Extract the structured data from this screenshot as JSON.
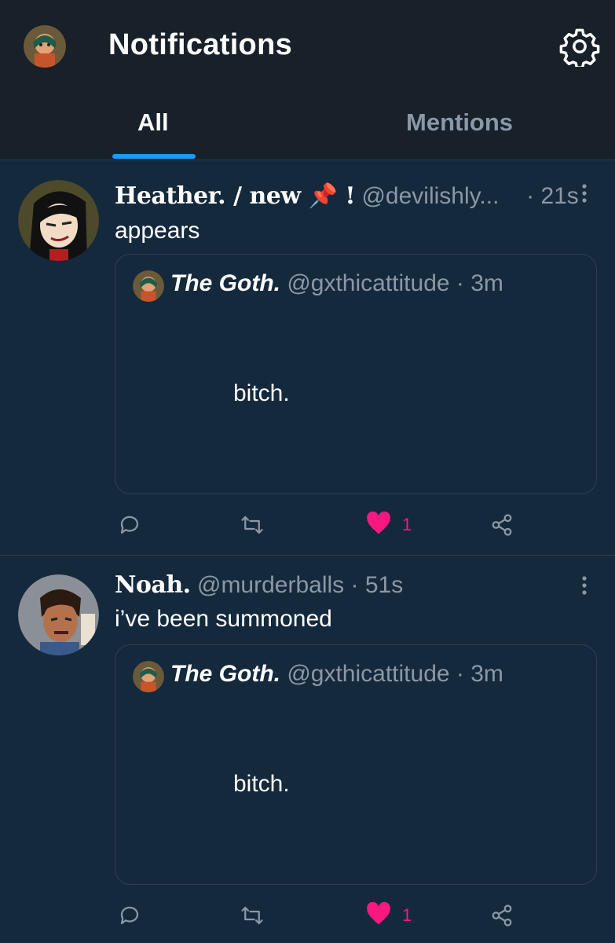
{
  "header": {
    "title": "Notifications",
    "tabs": [
      {
        "label": "All",
        "active": true
      },
      {
        "label": "Mentions",
        "active": false
      }
    ]
  },
  "notifications": [
    {
      "display_name": "Heather. / new 📌 !",
      "handle": "@devilishly...",
      "dot": "·",
      "time": "21s",
      "text": "appears",
      "quote": {
        "display_name": "The Goth.",
        "handle": "@gxthicattitude",
        "dot": "·",
        "time": "3m",
        "text": "bitch."
      },
      "actions": {
        "likes": "1"
      }
    },
    {
      "display_name": "Noah.",
      "handle": "@murderballs",
      "dot": "·",
      "time": "51s",
      "text": "i’ve been summoned",
      "quote": {
        "display_name": "The Goth.",
        "handle": "@gxthicattitude",
        "dot": "·",
        "time": "3m",
        "text": "bitch."
      },
      "actions": {
        "likes": "1"
      }
    }
  ],
  "colors": {
    "background": "#15293d",
    "header": "#18202a",
    "accent": "#1d9bf0",
    "like": "#f91880",
    "muted": "#8b98a5"
  },
  "icons": [
    "settings-gear-icon",
    "reply-icon",
    "retweet-icon",
    "heart-icon",
    "share-icon",
    "more-icon"
  ]
}
